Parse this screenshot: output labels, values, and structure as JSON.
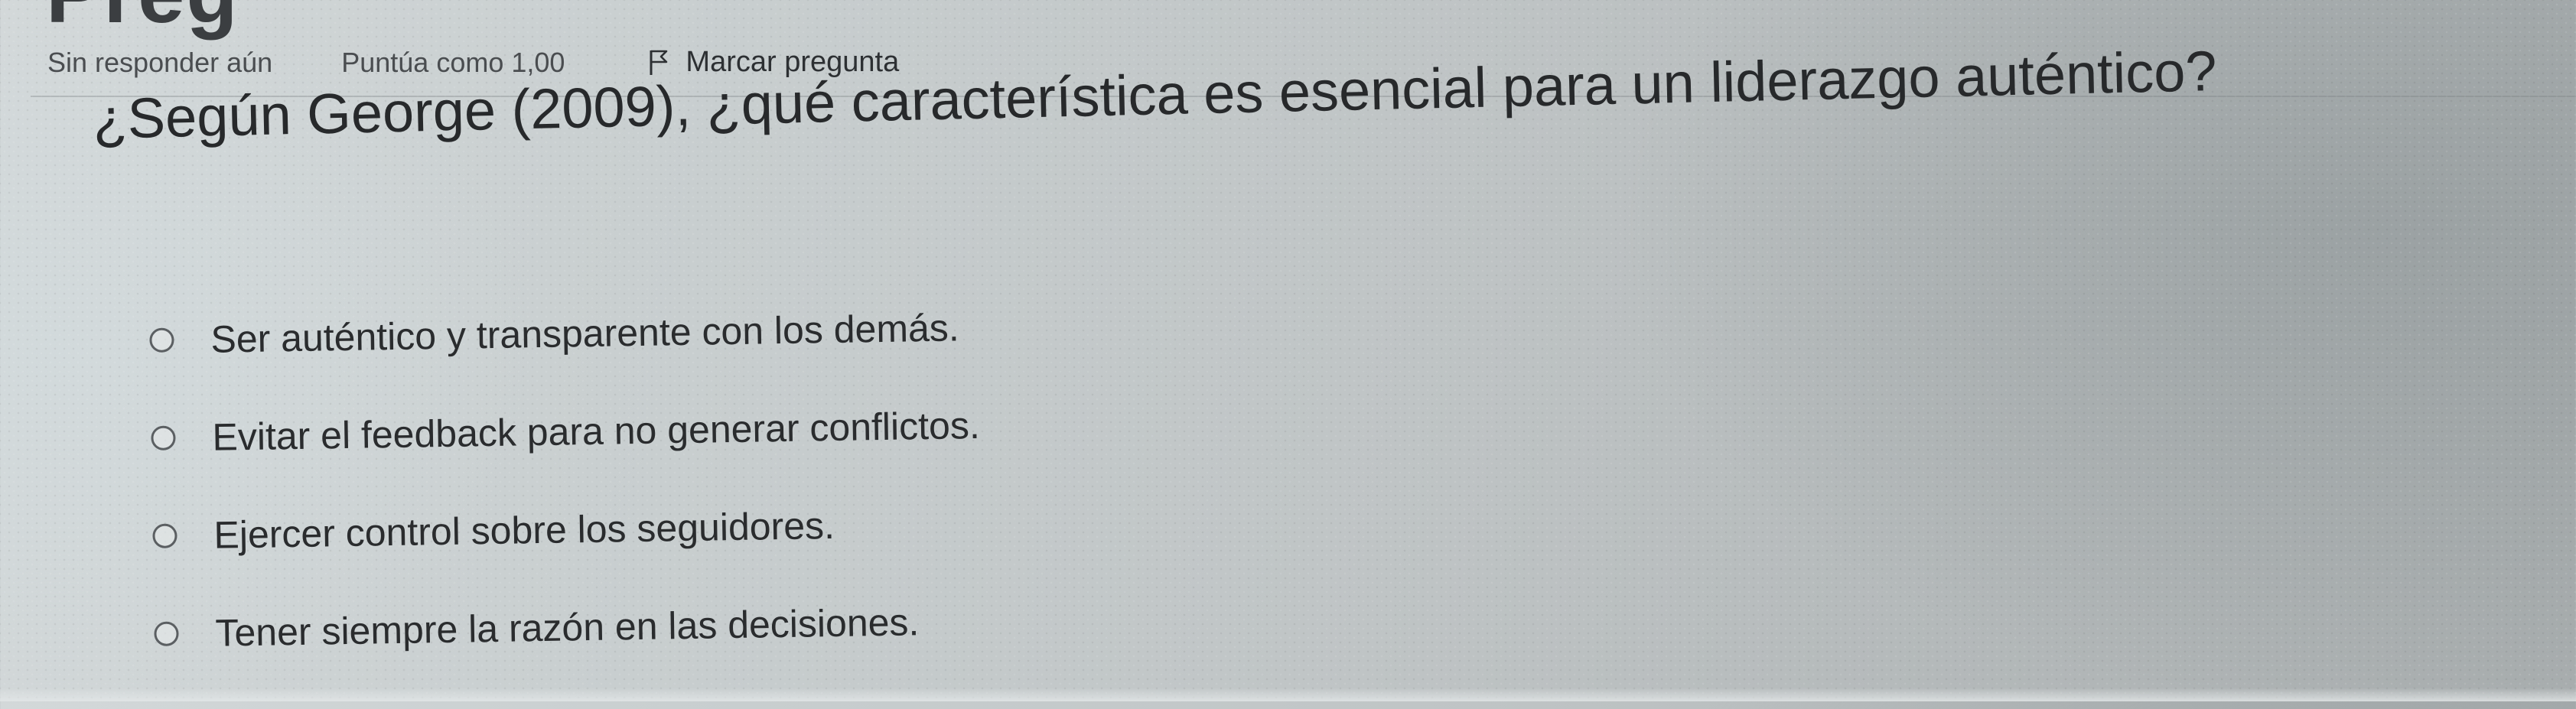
{
  "quiz": {
    "page_heading_fragment": "Preg",
    "info": {
      "status": "Sin responder aún",
      "score": "Puntúa como 1,00",
      "flag_label": "Marcar pregunta"
    },
    "question": {
      "text": "¿Según George (2009), ¿qué característica es esencial para un liderazgo auténtico?"
    },
    "options": [
      {
        "label": "Ser auténtico y transparente con los demás."
      },
      {
        "label": "Evitar el feedback para no generar conflictos."
      },
      {
        "label": "Ejercer control sobre los seguidores."
      },
      {
        "label": "Tener siempre la razón en las decisiones."
      }
    ],
    "icons": {
      "flag": "flag-icon",
      "radio": "radio-circle-icon"
    }
  }
}
